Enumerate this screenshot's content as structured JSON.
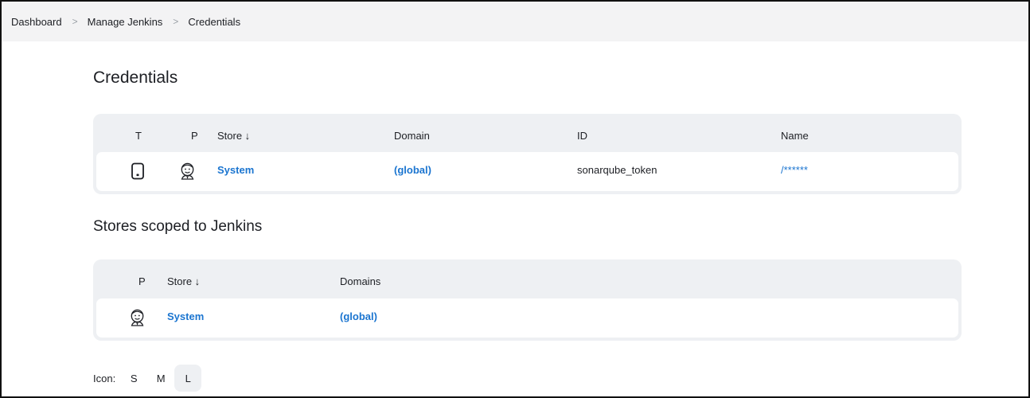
{
  "breadcrumb": {
    "items": [
      "Dashboard",
      "Manage Jenkins",
      "Credentials"
    ],
    "separator": ">"
  },
  "title": "Credentials",
  "credentials_table": {
    "headers": {
      "t": "T",
      "p": "P",
      "store": "Store ↓",
      "domain": "Domain",
      "id": "ID",
      "name": "Name"
    },
    "rows": [
      {
        "type_icon": "phone-credential-icon",
        "provider_icon": "jenkins-head-icon",
        "store": "System",
        "domain": "(global)",
        "id": "sonarqube_token",
        "name": "/******"
      }
    ]
  },
  "stores_section": {
    "title": "Stores scoped to Jenkins",
    "headers": {
      "p": "P",
      "store": "Store ↓",
      "domains": "Domains"
    },
    "rows": [
      {
        "provider_icon": "jenkins-head-icon",
        "store": "System",
        "domains": "(global)"
      }
    ]
  },
  "icon_size": {
    "label": "Icon:",
    "options": [
      "S",
      "M",
      "L"
    ],
    "selected": "L"
  },
  "colors": {
    "link": "#1b75d0",
    "table_bg": "#eef0f3",
    "breadcrumb_bg": "#f3f3f4"
  }
}
